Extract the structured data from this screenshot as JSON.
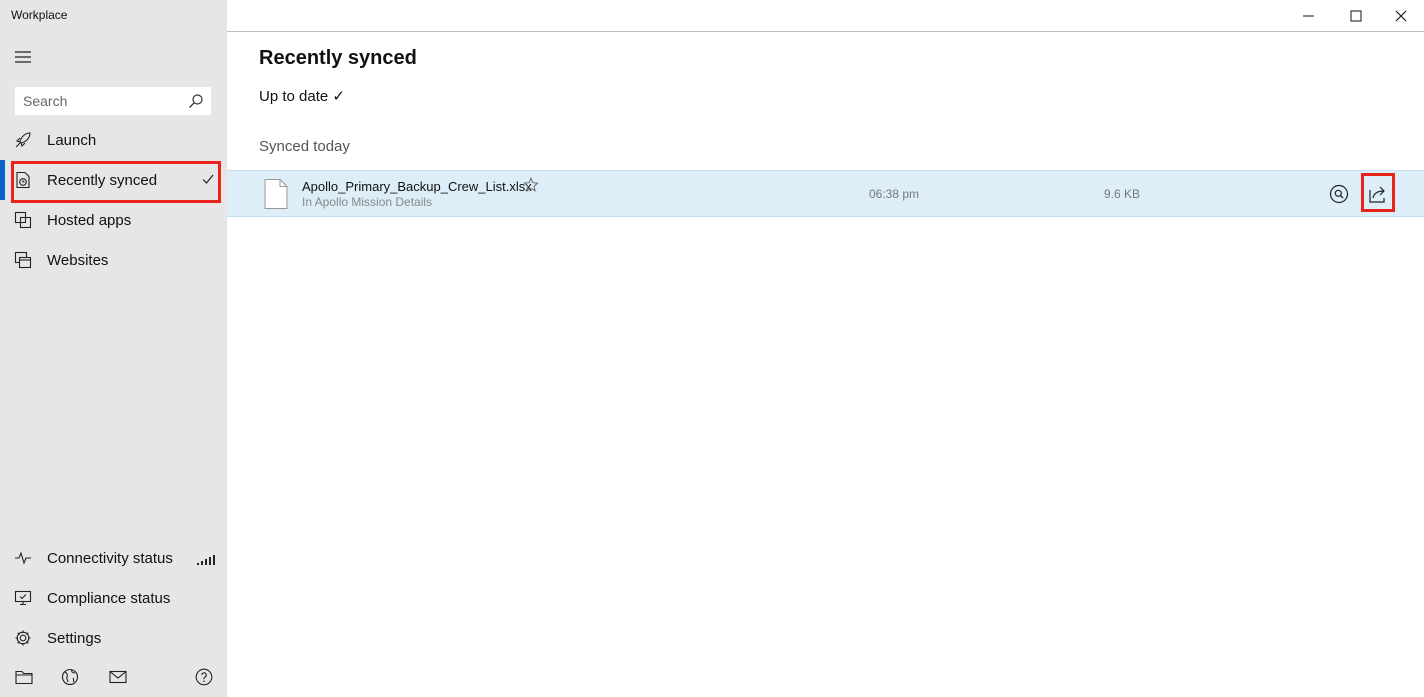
{
  "window": {
    "title": "Workplace",
    "controls": [
      "minimize",
      "maximize",
      "close"
    ]
  },
  "sidebar": {
    "search": {
      "placeholder": "Search",
      "value": ""
    },
    "nav_items": [
      {
        "label": "Launch",
        "icon": "rocket-icon"
      },
      {
        "label": "Recently synced",
        "icon": "recent-sync-icon",
        "selected": true,
        "trail": "check-icon"
      },
      {
        "label": "Hosted apps",
        "icon": "hosted-apps-icon"
      },
      {
        "label": "Websites",
        "icon": "websites-icon"
      }
    ],
    "bottom_items": [
      {
        "label": "Connectivity status",
        "icon": "pulse-icon",
        "trail": "signal-bars-icon"
      },
      {
        "label": "Compliance status",
        "icon": "monitor-check-icon"
      },
      {
        "label": "Settings",
        "icon": "gear-icon"
      }
    ],
    "footer_icons": [
      "folder-icon",
      "globe-icon",
      "mail-icon",
      "help-icon"
    ]
  },
  "main": {
    "title": "Recently synced",
    "status": "Up to date ✓",
    "section": "Synced today",
    "files": [
      {
        "name": "Apollo_Primary_Backup_Crew_List.xlsx",
        "location": "In Apollo Mission Details",
        "time": "06:38 pm",
        "size": "9.6 KB",
        "favorite": false
      }
    ]
  },
  "colors": {
    "sidebar_bg": "#e6e6e6",
    "accent": "#0a64c8",
    "row_highlight": "#ddeef9",
    "annotation_red": "#e8231a"
  }
}
